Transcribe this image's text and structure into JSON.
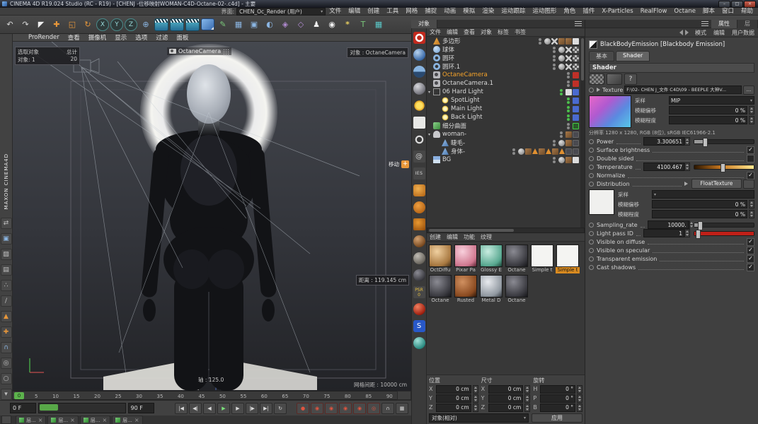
{
  "window": {
    "title": "CINEMA 4D R19.024 Studio (RC - R19) - [CHENJ -位移映射WOMAN-C4D-Octane-02-.c4d] - 主要",
    "min": "–",
    "max": "□",
    "close": "×"
  },
  "menubar": {
    "items": [
      "文件",
      "编辑",
      "创建",
      "工具",
      "网格",
      "捕捉",
      "动画",
      "模拟",
      "渲染",
      "运动跟踪",
      "运动图形",
      "角色",
      "插件",
      "X-Particles",
      "RealFlow",
      "Octane",
      "脚本",
      "窗口",
      "帮助"
    ],
    "interface_label": "界面:",
    "interface_value": "CHEN_Oc_Render (用户)"
  },
  "toolbar": {
    "icons": [
      {
        "name": "undo-icon",
        "glyph": "↶"
      },
      {
        "name": "redo-icon",
        "glyph": "↷"
      },
      {
        "name": "live-selection-icon",
        "glyph": "◤",
        "cls": "c-white"
      },
      {
        "name": "move-tool-icon",
        "glyph": "✚",
        "cls": "c-orange"
      },
      {
        "name": "scale-tool-icon",
        "glyph": "◱",
        "cls": "c-orange"
      },
      {
        "name": "rotate-tool-icon",
        "glyph": "↻",
        "cls": "c-orange"
      },
      {
        "name": "x-axis-lock",
        "glyph": "X",
        "cls": "axis"
      },
      {
        "name": "y-axis-lock",
        "glyph": "Y",
        "cls": "axis"
      },
      {
        "name": "z-axis-lock",
        "glyph": "Z",
        "cls": "axis"
      },
      {
        "name": "coord-system-icon",
        "glyph": "⊕",
        "cls": "c-blue"
      },
      {
        "name": "render-view-icon",
        "cls": "clap"
      },
      {
        "name": "render-settings-icon",
        "cls": "clap"
      },
      {
        "name": "render-queue-icon",
        "cls": "clap"
      },
      {
        "name": "primitive-cube-icon",
        "cls": "cube"
      },
      {
        "name": "spline-pen-icon",
        "glyph": "✎",
        "cls": "c-green"
      },
      {
        "name": "subdivision-surface-icon",
        "glyph": "▦",
        "cls": "c-blue"
      },
      {
        "name": "array-icon",
        "glyph": "▣",
        "cls": "c-blue"
      },
      {
        "name": "boole-icon",
        "glyph": "◐",
        "cls": "c-blue"
      },
      {
        "name": "instance-icon",
        "glyph": "◈",
        "cls": "c-purple"
      },
      {
        "name": "deformer-icon",
        "glyph": "◇",
        "cls": "c-purple"
      },
      {
        "name": "character-icon",
        "glyph": "♟",
        "cls": "c-white"
      },
      {
        "name": "camera-tool-icon",
        "glyph": "◉",
        "cls": "c-white"
      },
      {
        "name": "light-tool-icon",
        "glyph": "*",
        "cls": "c-yellow"
      },
      {
        "name": "motext-icon",
        "glyph": "T",
        "cls": "c-green"
      },
      {
        "name": "workplane-icon",
        "glyph": "▦",
        "cls": "c-teal"
      }
    ]
  },
  "left_toolbar": {
    "brand": "MAXON  CINEMA4D",
    "icons": [
      {
        "name": "convert-selection-icon",
        "glyph": "⇄"
      },
      {
        "name": "model-mode-icon",
        "glyph": "▣",
        "cls": "c-blue"
      },
      {
        "name": "texture-mode-icon",
        "glyph": "▨"
      },
      {
        "name": "workplane-mode-icon",
        "glyph": "▤"
      },
      {
        "name": "points-mode-icon",
        "glyph": "∴"
      },
      {
        "name": "edges-mode-icon",
        "glyph": "/"
      },
      {
        "name": "polygons-mode-icon",
        "glyph": "▲",
        "cls": "c-orange"
      },
      {
        "name": "axis-mode-icon",
        "glyph": "✚",
        "cls": "c-orange"
      },
      {
        "name": "snap-icon",
        "glyph": "∩",
        "cls": "c-blue"
      },
      {
        "name": "viewport-filter-icon",
        "glyph": "◎"
      },
      {
        "name": "solo-mode-icon",
        "glyph": "○"
      },
      {
        "name": "lock-icon",
        "glyph": "▾"
      }
    ]
  },
  "viewport": {
    "menus": [
      "查看",
      "摄像机",
      "显示",
      "选项",
      "过滤",
      "面板"
    ],
    "prorender": "ProRender",
    "sel_col1": "选取对象",
    "sel_col2": "总计",
    "sel_row1": "对象: 1",
    "sel_row2": "20",
    "camera_label": "OctaneCamera",
    "object_info": "对象 : OctaneCamera",
    "move_label": "移动",
    "move_plus": "+",
    "distance": "距离 : 119.145 cm",
    "axis": "轴 : 125.0",
    "grid": "网格间距 : 10000 cm"
  },
  "timeline": {
    "playhead": "0",
    "ticks": [
      "0",
      "5",
      "10",
      "15",
      "20",
      "25",
      "30",
      "35",
      "40",
      "45",
      "50",
      "55",
      "60",
      "65",
      "70",
      "75",
      "80",
      "85",
      "90"
    ]
  },
  "transport": {
    "start": "0 F",
    "end": "90 F",
    "buttons": [
      {
        "name": "goto-start-button",
        "glyph": "|◀"
      },
      {
        "name": "prev-key-button",
        "glyph": "◀|"
      },
      {
        "name": "prev-frame-button",
        "glyph": "◀"
      },
      {
        "name": "play-button",
        "glyph": "▶",
        "cls": "play"
      },
      {
        "name": "next-frame-button",
        "glyph": "▶"
      },
      {
        "name": "next-key-button",
        "glyph": "|▶"
      },
      {
        "name": "goto-end-button",
        "glyph": "▶|"
      },
      {
        "name": "loop-button",
        "glyph": "↻"
      },
      {
        "name": "record-keyframe-button",
        "glyph": "●",
        "cls": "rec"
      },
      {
        "name": "record-position-button",
        "glyph": "◉",
        "cls": "rec"
      },
      {
        "name": "record-scale-button",
        "glyph": "◉",
        "cls": "rec"
      },
      {
        "name": "record-rotation-button",
        "glyph": "◉",
        "cls": "rec"
      },
      {
        "name": "record-parameter-button",
        "glyph": "◉",
        "cls": "rec"
      },
      {
        "name": "autokey-button",
        "glyph": "◎",
        "cls": "rec"
      },
      {
        "name": "magnet-button",
        "glyph": "∩"
      },
      {
        "name": "grid-snap-button",
        "glyph": "▦"
      }
    ]
  },
  "bottom_tabs": {
    "items": [
      "层...",
      "层...",
      "层...",
      "层..."
    ]
  },
  "octane_dock": {
    "icons": [
      {
        "name": "octane-liveviewer-button",
        "cls": "d-red"
      },
      {
        "name": "octane-camera-button",
        "cls": "d-sphere-blue"
      },
      {
        "name": "octane-hdri-environment-button",
        "cls": "d-sphere-half"
      },
      {
        "name": "octane-material-button",
        "cls": "d-sphere-gray"
      },
      {
        "name": "octane-daylight-button",
        "cls": "d-sun"
      },
      {
        "name": "octane-arealight-button",
        "cls": "d-area"
      },
      {
        "name": "octane-targetlight-button",
        "cls": "d-ring"
      },
      {
        "name": "octane-spiral-button",
        "cls": "d-spiral",
        "text": "@"
      },
      {
        "name": "octane-ies-light-button",
        "cls": "d-ies",
        "text": "IES"
      },
      {
        "name": "octane-scatter-button",
        "cls": "d-orange"
      },
      {
        "name": "octane-fog-volume-button",
        "cls": "d-orange2"
      },
      {
        "name": "octane-vdb-button",
        "cls": "d-orange3"
      },
      {
        "name": "octane-texture-sphere-1",
        "cls": "d-sphere-brown"
      },
      {
        "name": "octane-texture-sphere-2",
        "cls": "d-sphere-rock"
      },
      {
        "name": "octane-texture-sphere-3",
        "cls": "d-sphere-dark"
      },
      {
        "name": "psr-reset-button",
        "cls": "d-psr",
        "text": "PSR 0"
      },
      {
        "name": "red-sphere-button",
        "cls": "d-sphere-red"
      },
      {
        "name": "octane-s-button",
        "cls": "d-s",
        "text": "S"
      },
      {
        "name": "teal-sphere-button",
        "cls": "d-sphere-teal"
      }
    ]
  },
  "object_manager": {
    "tab": "对象",
    "menus": [
      "文件",
      "编辑",
      "查看",
      "对象",
      "标签",
      "书签"
    ],
    "items": [
      {
        "name": "多边形",
        "icon": "i-polygon-icon",
        "cls": "d0",
        "arrow": "",
        "tags": [
          "phong",
          "xtag",
          "tex-brown",
          "tex-brown",
          "white"
        ]
      },
      {
        "name": "球体",
        "icon": "i-sphere-icon",
        "cls": "d0",
        "arrow": "",
        "tags": [
          "phong",
          "xtag",
          "checker"
        ]
      },
      {
        "name": "圆环",
        "icon": "i-torus-icon",
        "cls": "d0",
        "arrow": "",
        "tags": [
          "phong",
          "xtag",
          "checker"
        ]
      },
      {
        "name": "圆环.1",
        "icon": "i-torus-icon",
        "cls": "d0",
        "arrow": "",
        "tags": [
          "phong",
          "xtag",
          "checker"
        ]
      },
      {
        "name": "OctaneCamera",
        "icon": "i-camera-icon",
        "cls": "d0 sel",
        "arrow": "",
        "tags": [
          "octane-red"
        ]
      },
      {
        "name": "OctaneCamera.1",
        "icon": "i-camera-icon",
        "cls": "d0",
        "arrow": "",
        "tags": [
          "octane-red"
        ]
      },
      {
        "name": "06 Hard Light",
        "icon": "i-null-icon",
        "cls": "d0",
        "arrow": "▾",
        "dots": "dots-green",
        "tags": [
          "white",
          "blue"
        ]
      },
      {
        "name": "SpotLight",
        "icon": "i-light-icon",
        "cls": "d1",
        "arrow": "",
        "dots": "dots-green",
        "tags": [
          "blue"
        ]
      },
      {
        "name": "Main Light",
        "icon": "i-light-icon",
        "cls": "d1",
        "arrow": "",
        "dots": "dots-green",
        "tags": [
          "blue"
        ]
      },
      {
        "name": "Back Light",
        "icon": "i-light-icon",
        "cls": "d1",
        "arrow": "",
        "dots": "dots-green",
        "tags": [
          "blue"
        ]
      },
      {
        "name": "细分曲面",
        "icon": "i-subdiv-icon",
        "cls": "d0",
        "arrow": "",
        "tags": [
          "check-green"
        ]
      },
      {
        "name": "woman-",
        "icon": "i-figure-icon",
        "cls": "d0",
        "arrow": "▾",
        "tags": [
          "tex-brown",
          "tex-dark"
        ]
      },
      {
        "name": "睫毛-",
        "icon": "i-mesh-icon",
        "cls": "d1",
        "arrow": "",
        "tags": [
          "phong",
          "tex-brown",
          "tex-dark"
        ]
      },
      {
        "name": "身体-",
        "icon": "i-mesh-icon",
        "cls": "d1",
        "arrow": "",
        "tags": [
          "phong",
          "tex-brown",
          "warn",
          "tex-brown",
          "warn",
          "tex-brown",
          "warn",
          "tex-dark",
          "tex-dark"
        ]
      },
      {
        "name": "BG",
        "icon": "i-sky-icon",
        "cls": "d0",
        "arrow": "",
        "tags": [
          "phong",
          "tex-brown",
          "white"
        ]
      }
    ]
  },
  "material_manager": {
    "menus": [
      "创建",
      "编辑",
      "功能",
      "纹理"
    ],
    "materials": [
      {
        "name": "OctDiffu",
        "cls": "m-tan"
      },
      {
        "name": "Pixar Pa",
        "cls": "m-pink"
      },
      {
        "name": "Glossy E",
        "cls": "m-teal"
      },
      {
        "name": "Octane",
        "cls": "m-dark"
      },
      {
        "name": "Simple t",
        "cls": "m-white"
      },
      {
        "name": "Simple t",
        "cls": "m-white",
        "sel": "on"
      },
      {
        "name": "Octane",
        "cls": "m-dark"
      },
      {
        "name": "Rusted",
        "cls": "m-rust"
      },
      {
        "name": "Metal D",
        "cls": "m-metal"
      },
      {
        "name": "Octane",
        "cls": "m-dark"
      }
    ]
  },
  "coordinates": {
    "groups": [
      {
        "title": "位置",
        "rows": [
          {
            "axis": "X",
            "value": "0 cm"
          },
          {
            "axis": "Y",
            "value": "0 cm"
          },
          {
            "axis": "Z",
            "value": "0 cm"
          }
        ]
      },
      {
        "title": "尺寸",
        "rows": [
          {
            "axis": "X",
            "value": "0 cm"
          },
          {
            "axis": "Y",
            "value": "0 cm"
          },
          {
            "axis": "Z",
            "value": "0 cm"
          }
        ]
      },
      {
        "title": "旋转",
        "rows": [
          {
            "axis": "H",
            "value": "0 °"
          },
          {
            "axis": "P",
            "value": "0 °"
          },
          {
            "axis": "B",
            "value": "0 °"
          }
        ]
      }
    ],
    "mode": "对象(相对)",
    "apply": "应用"
  },
  "attributes": {
    "tabs": [
      {
        "label": "属性",
        "cls": "on"
      },
      {
        "label": "层",
        "cls": "off"
      }
    ],
    "mode_items": [
      "模式",
      "编辑",
      "用户数据"
    ],
    "object_title": "BlackBodyEmission [Blackbody Emission]",
    "subtabs": [
      {
        "label": "基本"
      },
      {
        "label": "Shader",
        "cls": "on"
      }
    ],
    "section": "Shader",
    "help": "?",
    "texture_label": "Texture",
    "texture_path": "F:\\02- CHEN J_文件 C4D\\09 - BEEPLE 大神V...",
    "browse": "...",
    "sampling_label": "采样",
    "sampling_value": "MIP",
    "blur_offset_label": "模糊偏移",
    "blur_offset_value": "0 %",
    "blur_scale_label": "模糊程度",
    "blur_scale_value": "0 %",
    "info": "分辨率 1280 x 1280, RGB (8位), sRGB IEC61966-2.1",
    "power_label": "Power",
    "power_value": "3.300651",
    "surface_label": "Surface brightness",
    "surface_check": "✓",
    "double_label": "Double sided",
    "double_check": "",
    "temp_label": "Temperature",
    "temp_value": "4100.467",
    "normalize_label": "Normalize",
    "normalize_check": "✓",
    "dist_label": "Distribution",
    "dist_value": "FloatTexture",
    "sampling2_label": "采样",
    "sampling2_value": "",
    "blur_offset2_label": "模糊偏移",
    "blur_offset2_value": "0 %",
    "blur_scale2_label": "模糊程度",
    "blur_scale2_value": "0 %",
    "rate_label": "Sampling_rate",
    "rate_value": "10000.",
    "pass_label": "Light pass ID",
    "pass_value": "1",
    "vis_diff_label": "Visible on diffuse",
    "vis_diff_check": "✓",
    "vis_spec_label": "Visible on specular",
    "vis_spec_check": "✓",
    "trans_label": "Transparent emission",
    "trans_check": "✓",
    "shadow_label": "Cast shadows",
    "shadow_check": "✓"
  }
}
